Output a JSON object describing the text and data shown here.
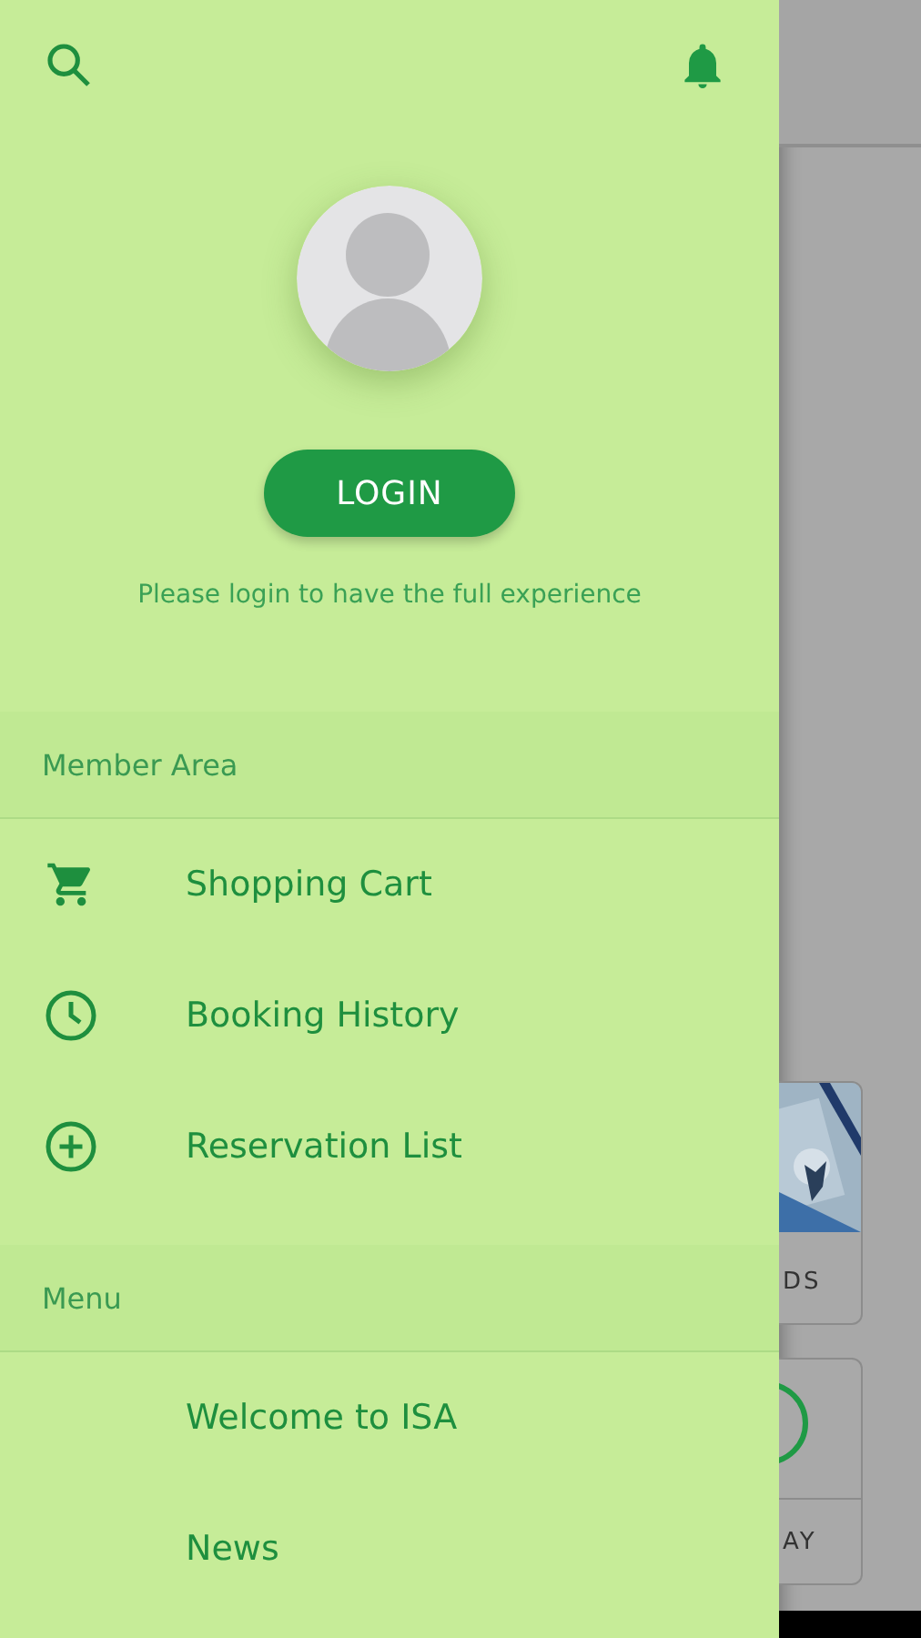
{
  "drawer": {
    "login_button": "LOGIN",
    "login_hint": "Please login to have the full experience",
    "sections": [
      {
        "title": "Member Area",
        "items": [
          {
            "label": "Shopping Cart",
            "kind": "cart"
          },
          {
            "label": "Booking History",
            "kind": "clock"
          },
          {
            "label": "Reservation List",
            "kind": "add"
          }
        ]
      },
      {
        "title": "Menu",
        "items": [
          {
            "label": "Welcome to ISA",
            "kind": "plain"
          },
          {
            "label": "News",
            "kind": "plain"
          }
        ]
      }
    ]
  },
  "background": {
    "cards": [
      {
        "kind": "picture",
        "label": "DS"
      },
      {
        "kind": "icon",
        "label": "AY"
      }
    ]
  }
}
